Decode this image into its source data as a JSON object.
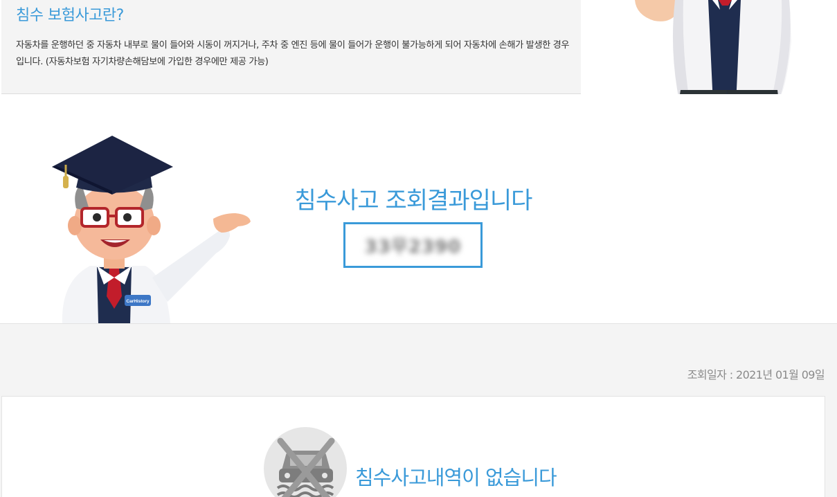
{
  "info": {
    "title": "침수 보험사고란?",
    "description": "자동차를 운행하던 중 자동차 내부로 물이 들어와 시동이 꺼지거나, 주차 중 엔진 등에 물이 들어가 운행이 불가능하게 되어 자동차에 손해가 발생한 경우입니다. (자동차보험 자기차량손해담보에 가입한 경우에만 제공 가능)"
  },
  "result": {
    "title": "침수사고 조회결과입니다",
    "plate_number": "33무2390"
  },
  "badge_text": "CarHistory",
  "query": {
    "date_label": "조회일자 : 2021년 01월 09일"
  },
  "no_record": {
    "message": "침수사고내역이 없습니다"
  },
  "colors": {
    "accent": "#3a9ad9",
    "panel_bg": "#f4f4f4",
    "text": "#333333",
    "muted": "#8a8a8a"
  },
  "icons": [
    "doctor-standing-illustration",
    "doctor-pointing-illustration",
    "flooded-car-crossed-icon"
  ]
}
